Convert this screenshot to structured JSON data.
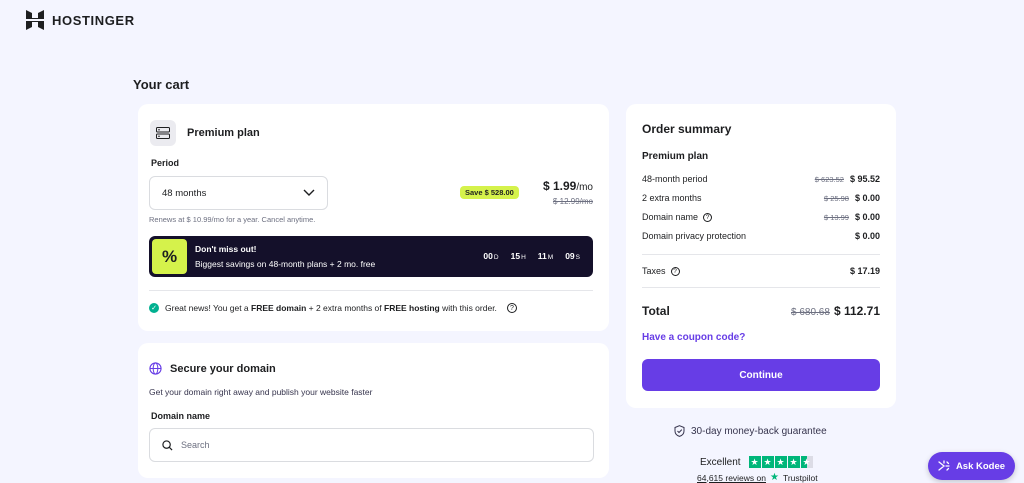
{
  "header": {
    "brand": "HOSTINGER",
    "logo_icon": "hostinger-logo-icon"
  },
  "cart_title": "Your cart",
  "plan": {
    "name": "Premium plan",
    "icon": "server-icon",
    "period_label": "Period",
    "period_value": "48 months",
    "renew_note": "Renews at $ 10.99/mo for a year. Cancel anytime.",
    "save_badge": "Save $ 528.00",
    "price": "$ 1.99",
    "price_unit": "/mo",
    "old_price": "$ 12.99/mo",
    "promo": {
      "percent": "%",
      "title": "Don't miss out!",
      "subtitle": "Biggest savings on 48-month plans + 2 mo. free",
      "countdown": [
        {
          "value": "00",
          "unit": "D"
        },
        {
          "value": "15",
          "unit": "H"
        },
        {
          "value": "11",
          "unit": "M"
        },
        {
          "value": "09",
          "unit": "S"
        }
      ]
    },
    "free_msg_prefix": "Great news! You get a ",
    "free_msg_domain": "FREE domain",
    "free_msg_middle": " + 2 extra months of ",
    "free_msg_hosting": "FREE hosting",
    "free_msg_suffix": " with this order."
  },
  "domain": {
    "title": "Secure your domain",
    "description": "Get your domain right away and publish your website faster",
    "label": "Domain name",
    "placeholder": "Search"
  },
  "summary": {
    "title": "Order summary",
    "plan_name": "Premium plan",
    "rows": [
      {
        "label": "48-month period",
        "old": "$ 623.52",
        "new": "$ 95.52"
      },
      {
        "label": "2 extra months",
        "old": "$ 25.98",
        "new": "$ 0.00"
      },
      {
        "label": "Domain name",
        "old": "$ 13.99",
        "new": "$ 0.00"
      },
      {
        "label": "Domain privacy protection",
        "old": "",
        "new": "$ 0.00"
      }
    ],
    "taxes_label": "Taxes",
    "taxes_value": "$ 17.19",
    "total_label": "Total",
    "total_old": "$ 680.68",
    "total_new": "$ 112.71",
    "coupon": "Have a coupon code?",
    "continue": "Continue"
  },
  "guarantee": "30-day money-back guarantee",
  "trustpilot": {
    "rating_text": "Excellent",
    "reviews": "64,615 reviews on",
    "brand": "Trustpilot"
  },
  "ask_button": "Ask Kodee",
  "colors": {
    "accent": "#673de6",
    "lime": "#d5f24b",
    "dark": "#14102a",
    "green": "#00b67a"
  }
}
